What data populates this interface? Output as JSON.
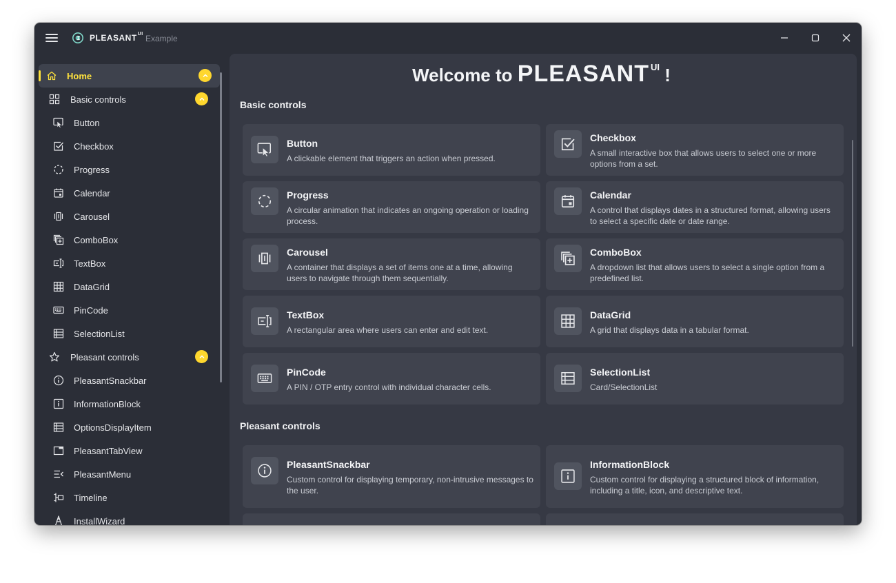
{
  "titlebar": {
    "app_name": "PLEASANT",
    "app_name_sup": "UI",
    "subtitle": "Example"
  },
  "sidebar": {
    "items": [
      {
        "label": "Home",
        "icon": "home-icon",
        "selected": true
      },
      {
        "label": "Basic controls",
        "icon": "grid-icon"
      },
      {
        "label": "Button",
        "icon": "cursor-click-icon"
      },
      {
        "label": "Checkbox",
        "icon": "checkbox-icon"
      },
      {
        "label": "Progress",
        "icon": "progress-ring-icon"
      },
      {
        "label": "Calendar",
        "icon": "calendar-icon"
      },
      {
        "label": "Carousel",
        "icon": "carousel-icon"
      },
      {
        "label": "ComboBox",
        "icon": "combobox-icon"
      },
      {
        "label": "TextBox",
        "icon": "textbox-icon"
      },
      {
        "label": "DataGrid",
        "icon": "table-icon"
      },
      {
        "label": "PinCode",
        "icon": "keyboard-icon"
      },
      {
        "label": "SelectionList",
        "icon": "list-icon"
      },
      {
        "label": "Pleasant controls",
        "icon": "star-icon"
      },
      {
        "label": "PleasantSnackbar",
        "icon": "info-circle-icon"
      },
      {
        "label": "InformationBlock",
        "icon": "info-square-icon"
      },
      {
        "label": "OptionsDisplayItem",
        "icon": "list-icon"
      },
      {
        "label": "PleasantTabView",
        "icon": "tab-view-icon"
      },
      {
        "label": "PleasantMenu",
        "icon": "menu-icon"
      },
      {
        "label": "Timeline",
        "icon": "timeline-icon"
      },
      {
        "label": "InstallWizard",
        "icon": "wizard-icon"
      }
    ]
  },
  "content": {
    "welcome_prefix": "Welcome to",
    "welcome_brand": "PLEASANT",
    "welcome_sup": "UI",
    "welcome_suffix": "!",
    "sections": [
      {
        "title": "Basic controls",
        "cards": [
          {
            "title": "Button",
            "desc": "A clickable element that triggers an action when pressed.",
            "icon": "cursor-click-icon"
          },
          {
            "title": "Checkbox",
            "desc": "A small interactive box that allows users to select one or more options from a set.",
            "icon": "checkbox-icon"
          },
          {
            "title": "Progress",
            "desc": "A circular animation that indicates an ongoing operation or loading process.",
            "icon": "progress-ring-icon"
          },
          {
            "title": "Calendar",
            "desc": "A control that displays dates in a structured format, allowing users to select a specific date or date range.",
            "icon": "calendar-icon"
          },
          {
            "title": "Carousel",
            "desc": "A container that displays a set of items one at a time, allowing users to navigate through them sequentially.",
            "icon": "carousel-icon"
          },
          {
            "title": "ComboBox",
            "desc": "A dropdown list that allows users to select a single option from a predefined list.",
            "icon": "combobox-icon"
          },
          {
            "title": "TextBox",
            "desc": "A rectangular area where users can enter and edit text.",
            "icon": "textbox-icon"
          },
          {
            "title": "DataGrid",
            "desc": "A grid that displays data in a tabular format.",
            "icon": "table-icon"
          },
          {
            "title": "PinCode",
            "desc": "A PIN / OTP entry control with individual character cells.",
            "icon": "keyboard-icon"
          },
          {
            "title": "SelectionList",
            "desc": "Card/SelectionList",
            "icon": "list-icon"
          }
        ]
      },
      {
        "title": "Pleasant controls",
        "cards": [
          {
            "title": "PleasantSnackbar",
            "desc": "Custom control for displaying temporary, non-intrusive messages to the user.",
            "icon": "info-circle-icon"
          },
          {
            "title": "InformationBlock",
            "desc": "Custom control for displaying a structured block of information, including a title, icon, and descriptive text.",
            "icon": "info-square-icon"
          }
        ]
      }
    ]
  },
  "colors": {
    "accent": "#ffe23d",
    "window_bg": "#2b2e37",
    "content_bg": "#363944",
    "card_bg": "#40434e"
  }
}
